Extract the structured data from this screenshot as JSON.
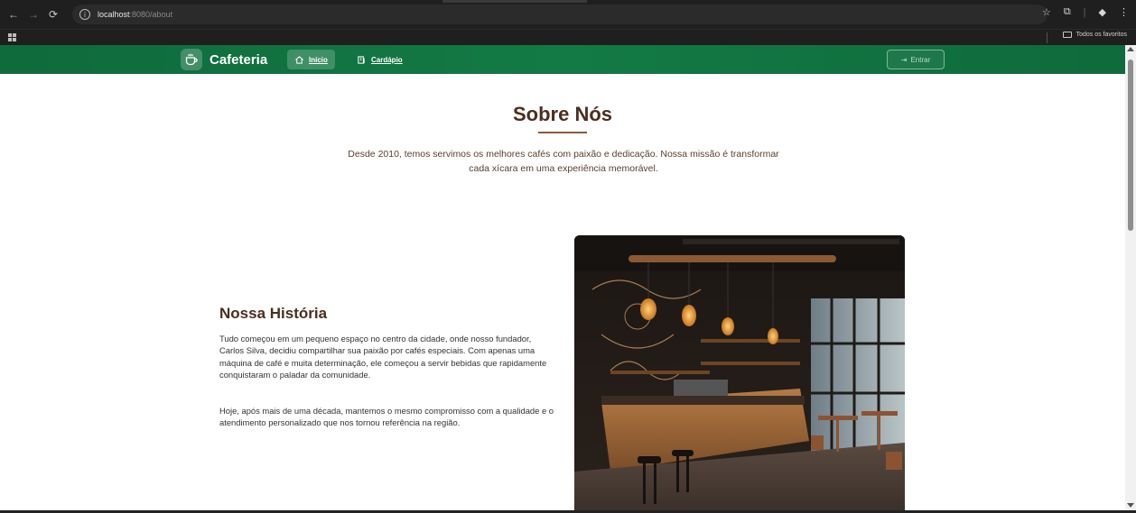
{
  "browser": {
    "url_host": "localhost",
    "url_path": ":8080/about",
    "bookmarks_folder": "Todos os favoritos"
  },
  "navbar": {
    "brand": "Cafeteria",
    "links": [
      {
        "label": "Início"
      },
      {
        "label": "Cardápio"
      }
    ],
    "login_label": "Entrar"
  },
  "about": {
    "title": "Sobre Nós",
    "intro": "Desde 2010, temos servimos os melhores cafés com paixão e dedicação. Nossa missão é transformar cada xícara em uma experiência memorável."
  },
  "history": {
    "title": "Nossa História",
    "paragraph1": "Tudo começou em um pequeno espaço no centro da cidade, onde nosso fundador, Carlos Silva, decidiu compartilhar sua paixão por cafés especiais. Com apenas uma máquina de café e muita determinação, ele começou a servir bebidas que rapidamente conquistaram o paladar da comunidade.",
    "paragraph2": "Hoje, após mais de uma década, mantemos o mesmo compromisso com a qualidade e o atendimento personalizado que nos tornou referência na região."
  },
  "colors": {
    "navbar_green": "#137a45",
    "heading_brown": "#4b2e20",
    "accent_brown": "#8b5a3c"
  }
}
